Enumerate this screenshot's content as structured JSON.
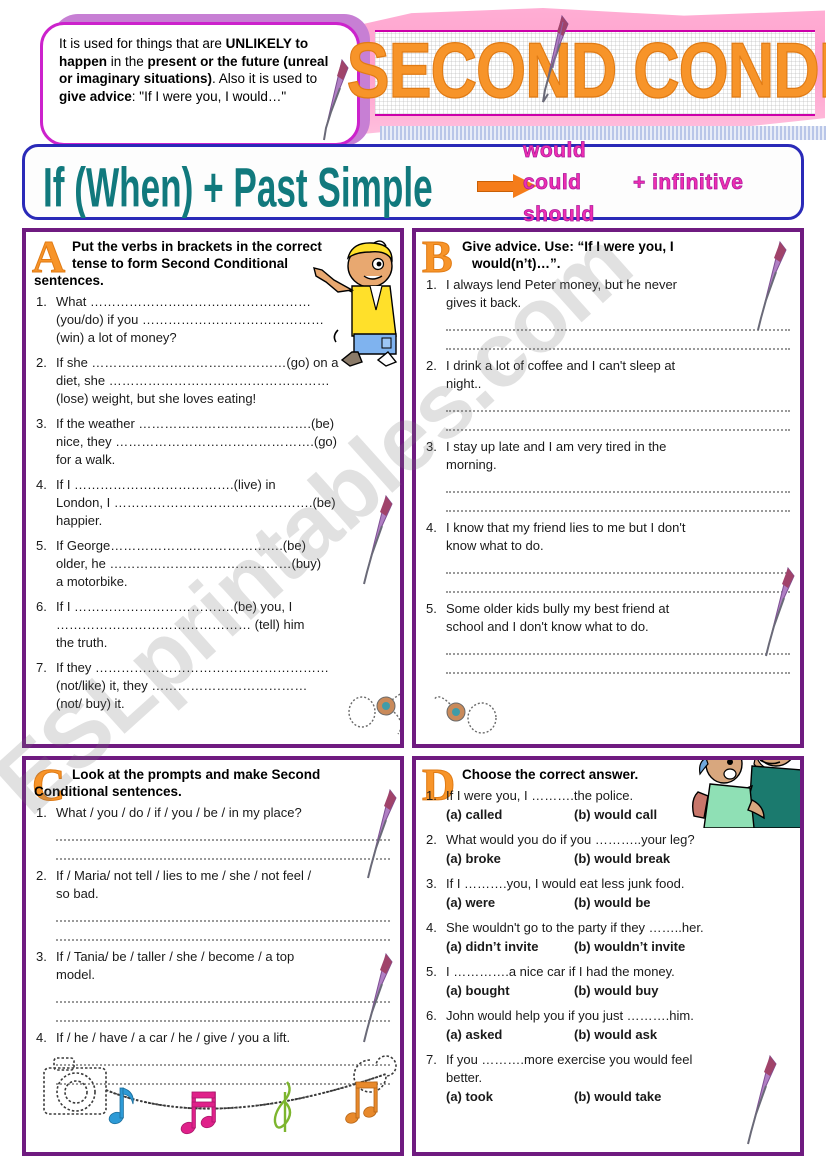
{
  "header": {
    "title": "SECOND CONDITIONAL",
    "intro_html": "It is used for things that are <b>UNLIKELY to happen</b> in the <b>present or the future (unreal or imaginary situations)</b>. Also it is used to <b>give advice</b>: \"If I were you, I would…\"",
    "formula_left": "If (When) + Past Simple",
    "modals": [
      "would",
      "could",
      "should"
    ],
    "infinitive": "+ infinitive"
  },
  "watermark": "ESLprintables.com",
  "colors": {
    "panel_border": "#6f1b80",
    "letter_orange": "#f79429",
    "banner_pink": "#ff9ecb",
    "formula_teal": "#11797d",
    "modal_magenta": "#ee2fb0",
    "formula_border_blue": "#2a2ab8",
    "intro_border_magenta": "#cc22cc",
    "arrow_orange": "#f57c1a"
  },
  "exercises": {
    "a": {
      "letter": "A",
      "title_line1": "Put the verbs in brackets in the correct",
      "title_line2": "tense to form Second Conditional",
      "title_line3": "sentences.",
      "items": [
        {
          "num": "1.",
          "lines": [
            "What ……………………………………………",
            "(you/do) if you ……………………………………",
            "(win) a lot of money?"
          ]
        },
        {
          "num": "2.",
          "lines": [
            "If she ………………………………………(go) on a",
            "diet, she ……………………………………………",
            "(lose) weight, but she loves eating!"
          ]
        },
        {
          "num": "3.",
          "lines": [
            "If the weather ………………………………….(be)",
            "nice, they ……………………………………….(go)",
            "for a walk."
          ]
        },
        {
          "num": "4.",
          "lines": [
            "If I ……………………………….(live) in",
            "London, I ……………………………………….(be)",
            "happier."
          ]
        },
        {
          "num": "5.",
          "lines": [
            "If George………………………………….(be)",
            "older, he ……………………………………(buy)",
            "a motorbike."
          ]
        },
        {
          "num": "6.",
          "lines": [
            "If I ……………………………….(be) you, I",
            "……………………………………… (tell) him",
            "the truth."
          ]
        },
        {
          "num": "7.",
          "lines": [
            "If they ………………………………………………",
            "(not/like) it, they ………………………………",
            "(not/ buy) it."
          ]
        }
      ]
    },
    "b": {
      "letter": "B",
      "title_line1": "Give advice. Use: “If I were you, I",
      "title_line2": "would(n’t)…”.",
      "items": [
        {
          "num": "1.",
          "lines": [
            "I always lend Peter money, but he never",
            "gives it back."
          ],
          "blanks": 2
        },
        {
          "num": "2.",
          "lines": [
            "I drink a lot of coffee and I can't sleep at",
            "night.."
          ],
          "blanks": 2
        },
        {
          "num": "3.",
          "lines": [
            "I stay up late and I am very tired in the",
            "morning."
          ],
          "blanks": 2
        },
        {
          "num": "4.",
          "lines": [
            "I know that my friend lies to me but I don't",
            "know what to do."
          ],
          "blanks": 2
        },
        {
          "num": "5.",
          "lines": [
            "Some older kids bully my best friend at",
            "school and I don't know what to do."
          ],
          "blanks": 2
        }
      ]
    },
    "c": {
      "letter": "C",
      "title_line1": "Look at the prompts and make Second",
      "title_line2": "Conditional sentences.",
      "items": [
        {
          "num": "1.",
          "lines": [
            "What / you / do / if / you / be / in my place?"
          ],
          "blanks": 2
        },
        {
          "num": "2.",
          "lines": [
            "If / Maria/ not tell / lies to me / she / not feel /",
            "so bad."
          ],
          "blanks": 2
        },
        {
          "num": "3.",
          "lines": [
            "If / Tania/ be / taller / she / become / a top",
            "model."
          ],
          "blanks": 2
        },
        {
          "num": "4.",
          "lines": [
            "If / he / have / a car / he / give / you a lift."
          ],
          "blanks": 2
        }
      ]
    },
    "d": {
      "letter": "D",
      "title_line1": "Choose the correct answer.",
      "items": [
        {
          "num": "1.",
          "lines": [
            "If I were you, I ……….the police."
          ],
          "a": "(a) called",
          "b": "(b) would call"
        },
        {
          "num": "2.",
          "lines": [
            "What would you do if you ………..your leg?"
          ],
          "a": "(a) broke",
          "b": "(b) would break"
        },
        {
          "num": "3.",
          "lines": [
            "If I ……….you, I would eat less junk food."
          ],
          "a": "(a) were",
          "b": "(b) would be"
        },
        {
          "num": "4.",
          "lines": [
            "She wouldn't go to the party if they ……..her."
          ],
          "a": "(a) didn’t invite",
          "b": "(b) wouldn’t invite"
        },
        {
          "num": "5.",
          "lines": [
            "I ………….a nice car if I had the money."
          ],
          "a": "(a) bought",
          "b": "(b) would buy"
        },
        {
          "num": "6.",
          "lines": [
            "John would help you if you just ……….him."
          ],
          "a": "(a) asked",
          "b": "(b) would ask"
        },
        {
          "num": "7.",
          "lines": [
            "If you ……….more exercise you would feel",
            "better."
          ],
          "a": "(a) took",
          "b": "(b) would take"
        }
      ]
    }
  }
}
